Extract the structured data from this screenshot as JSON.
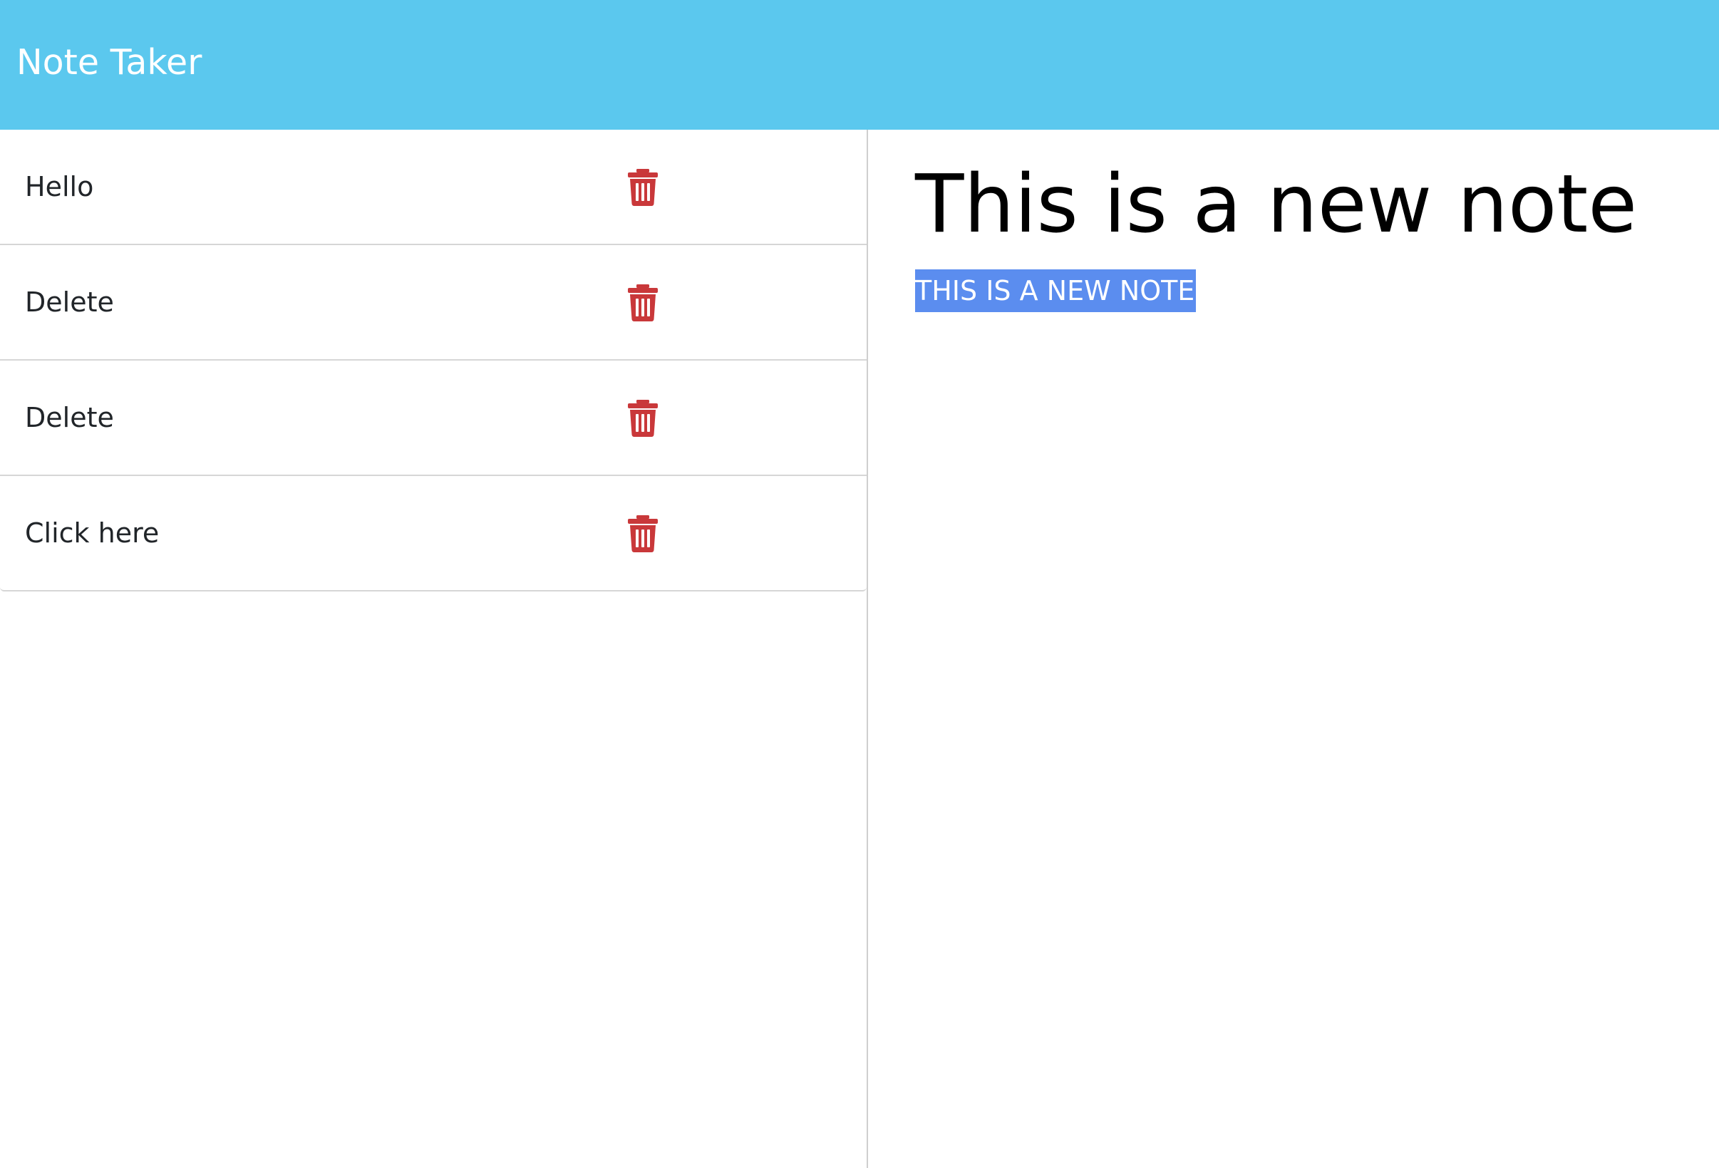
{
  "app": {
    "brand": "Note Taker"
  },
  "colors": {
    "navbar": "#5bc8ee",
    "delete_icon": "#c9383a",
    "selection": "#5b8def"
  },
  "notes": [
    {
      "title": "Hello",
      "icon": "trash-icon"
    },
    {
      "title": "Delete",
      "icon": "trash-icon"
    },
    {
      "title": "Delete",
      "icon": "trash-icon"
    },
    {
      "title": "Click here",
      "icon": "trash-icon"
    }
  ],
  "active_note": {
    "title": "This is a new note",
    "text": "THIS IS A NEW NOTE"
  }
}
